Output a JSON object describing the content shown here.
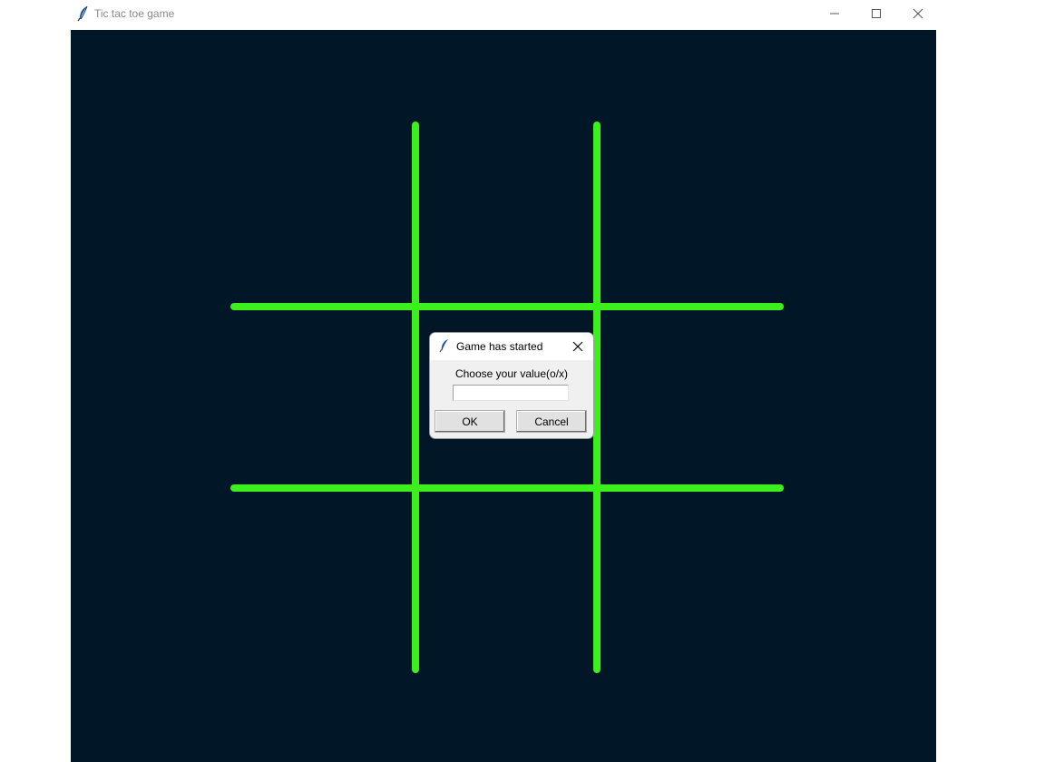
{
  "window": {
    "title": "Tic tac toe game",
    "icon": "feather-icon",
    "controls": {
      "minimize": "minimize-icon",
      "maximize": "maximize-icon",
      "close": "close-icon"
    }
  },
  "canvas": {
    "background_color": "#011627",
    "grid_color": "#3cf01e",
    "grid_lines": 4,
    "cells": [
      "",
      "",
      "",
      "",
      "",
      "",
      "",
      "",
      ""
    ]
  },
  "dialog": {
    "title": "Game has started",
    "icon": "feather-icon",
    "close": "close-icon",
    "prompt": "Choose your value(o/x)",
    "entry_value": "",
    "ok_label": "OK",
    "cancel_label": "Cancel"
  }
}
